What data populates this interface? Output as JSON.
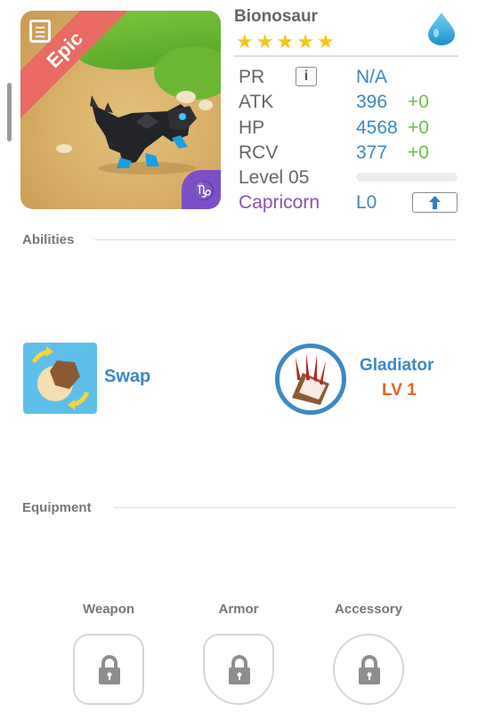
{
  "monster": {
    "name": "Bionosaur",
    "rarity": "Epic",
    "stars": 5,
    "element_icon": "water-drop-icon",
    "zodiac_badge_icon": "capricorn-symbol-icon"
  },
  "stats": {
    "pr": {
      "label": "PR",
      "value": "N/A",
      "info_icon": "info-icon"
    },
    "atk": {
      "label": "ATK",
      "value": "396",
      "bonus": "+0"
    },
    "hp": {
      "label": "HP",
      "value": "4568",
      "bonus": "+0"
    },
    "rcv": {
      "label": "RCV",
      "value": "377",
      "bonus": "+0"
    },
    "level": {
      "label": "Level 05",
      "progress": 0
    },
    "zodiac": {
      "label": "Capricorn",
      "value": "L0",
      "upgrade_icon": "arrow-up-icon"
    }
  },
  "abilities": {
    "title": "Abilities",
    "active": {
      "name": "Swap",
      "icon": "swap-ability-icon"
    },
    "passive": {
      "name": "Gladiator",
      "level": "LV 1",
      "icon": "gladiator-claw-icon"
    }
  },
  "equipment": {
    "title": "Equipment",
    "slots": [
      {
        "label": "Weapon",
        "icon": "lock-icon"
      },
      {
        "label": "Armor",
        "icon": "lock-icon"
      },
      {
        "label": "Accessory",
        "icon": "lock-icon"
      }
    ]
  },
  "colors": {
    "accent_blue": "#3d88c5",
    "bonus_green": "#6abf45",
    "epic_ribbon": "#e86a63",
    "zodiac_purple": "#8a52b8",
    "star_gold": "#f5c51b",
    "level_orange": "#e2671e"
  }
}
